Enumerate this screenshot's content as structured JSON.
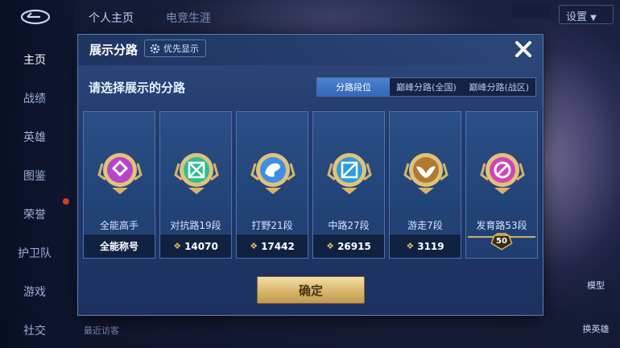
{
  "nav": {
    "items": [
      "主页",
      "战绩",
      "英雄",
      "图鉴",
      "荣誉",
      "护卫队",
      "游戏",
      "社交"
    ],
    "active": "主页"
  },
  "topbar": {
    "tabs": [
      "个人主页",
      "电竞生涯"
    ],
    "settings": "设置"
  },
  "right_rail": {
    "model": "模型",
    "change_hero": "换英雄"
  },
  "visitors": {
    "label": "最近访客"
  },
  "dialog": {
    "title": "展示分路",
    "priority_button": "优先显示",
    "prompt": "请选择展示的分路",
    "tabs": [
      "分路段位",
      "巅峰分路(全国)",
      "巅峰分路(战区)"
    ],
    "active_tab": "分路段位",
    "confirm": "确定",
    "cards": [
      {
        "name": "全能高手",
        "stat": "全能称号",
        "show_mark": false,
        "emblem": "allround-emblem",
        "color": "#b545c9"
      },
      {
        "name": "对抗路19段",
        "stat": "14070",
        "show_mark": true,
        "emblem": "clash-lane-emblem",
        "color": "#2fbf8f"
      },
      {
        "name": "打野21段",
        "stat": "17442",
        "show_mark": true,
        "emblem": "jungle-emblem",
        "color": "#3f8ee6"
      },
      {
        "name": "中路27段",
        "stat": "26915",
        "show_mark": true,
        "emblem": "mid-lane-emblem",
        "color": "#2c9ce0"
      },
      {
        "name": "游走7段",
        "stat": "3119",
        "show_mark": true,
        "emblem": "roam-emblem",
        "color": "#b07a30"
      },
      {
        "name": "发育路53段",
        "stat": "50",
        "show_mark": false,
        "emblem": "farm-lane-emblem",
        "color": "#d043b8"
      }
    ]
  },
  "colors": {
    "accent_gold": "#d9b56c",
    "tab_active": "#3f75c6",
    "panel": "#22396a"
  }
}
